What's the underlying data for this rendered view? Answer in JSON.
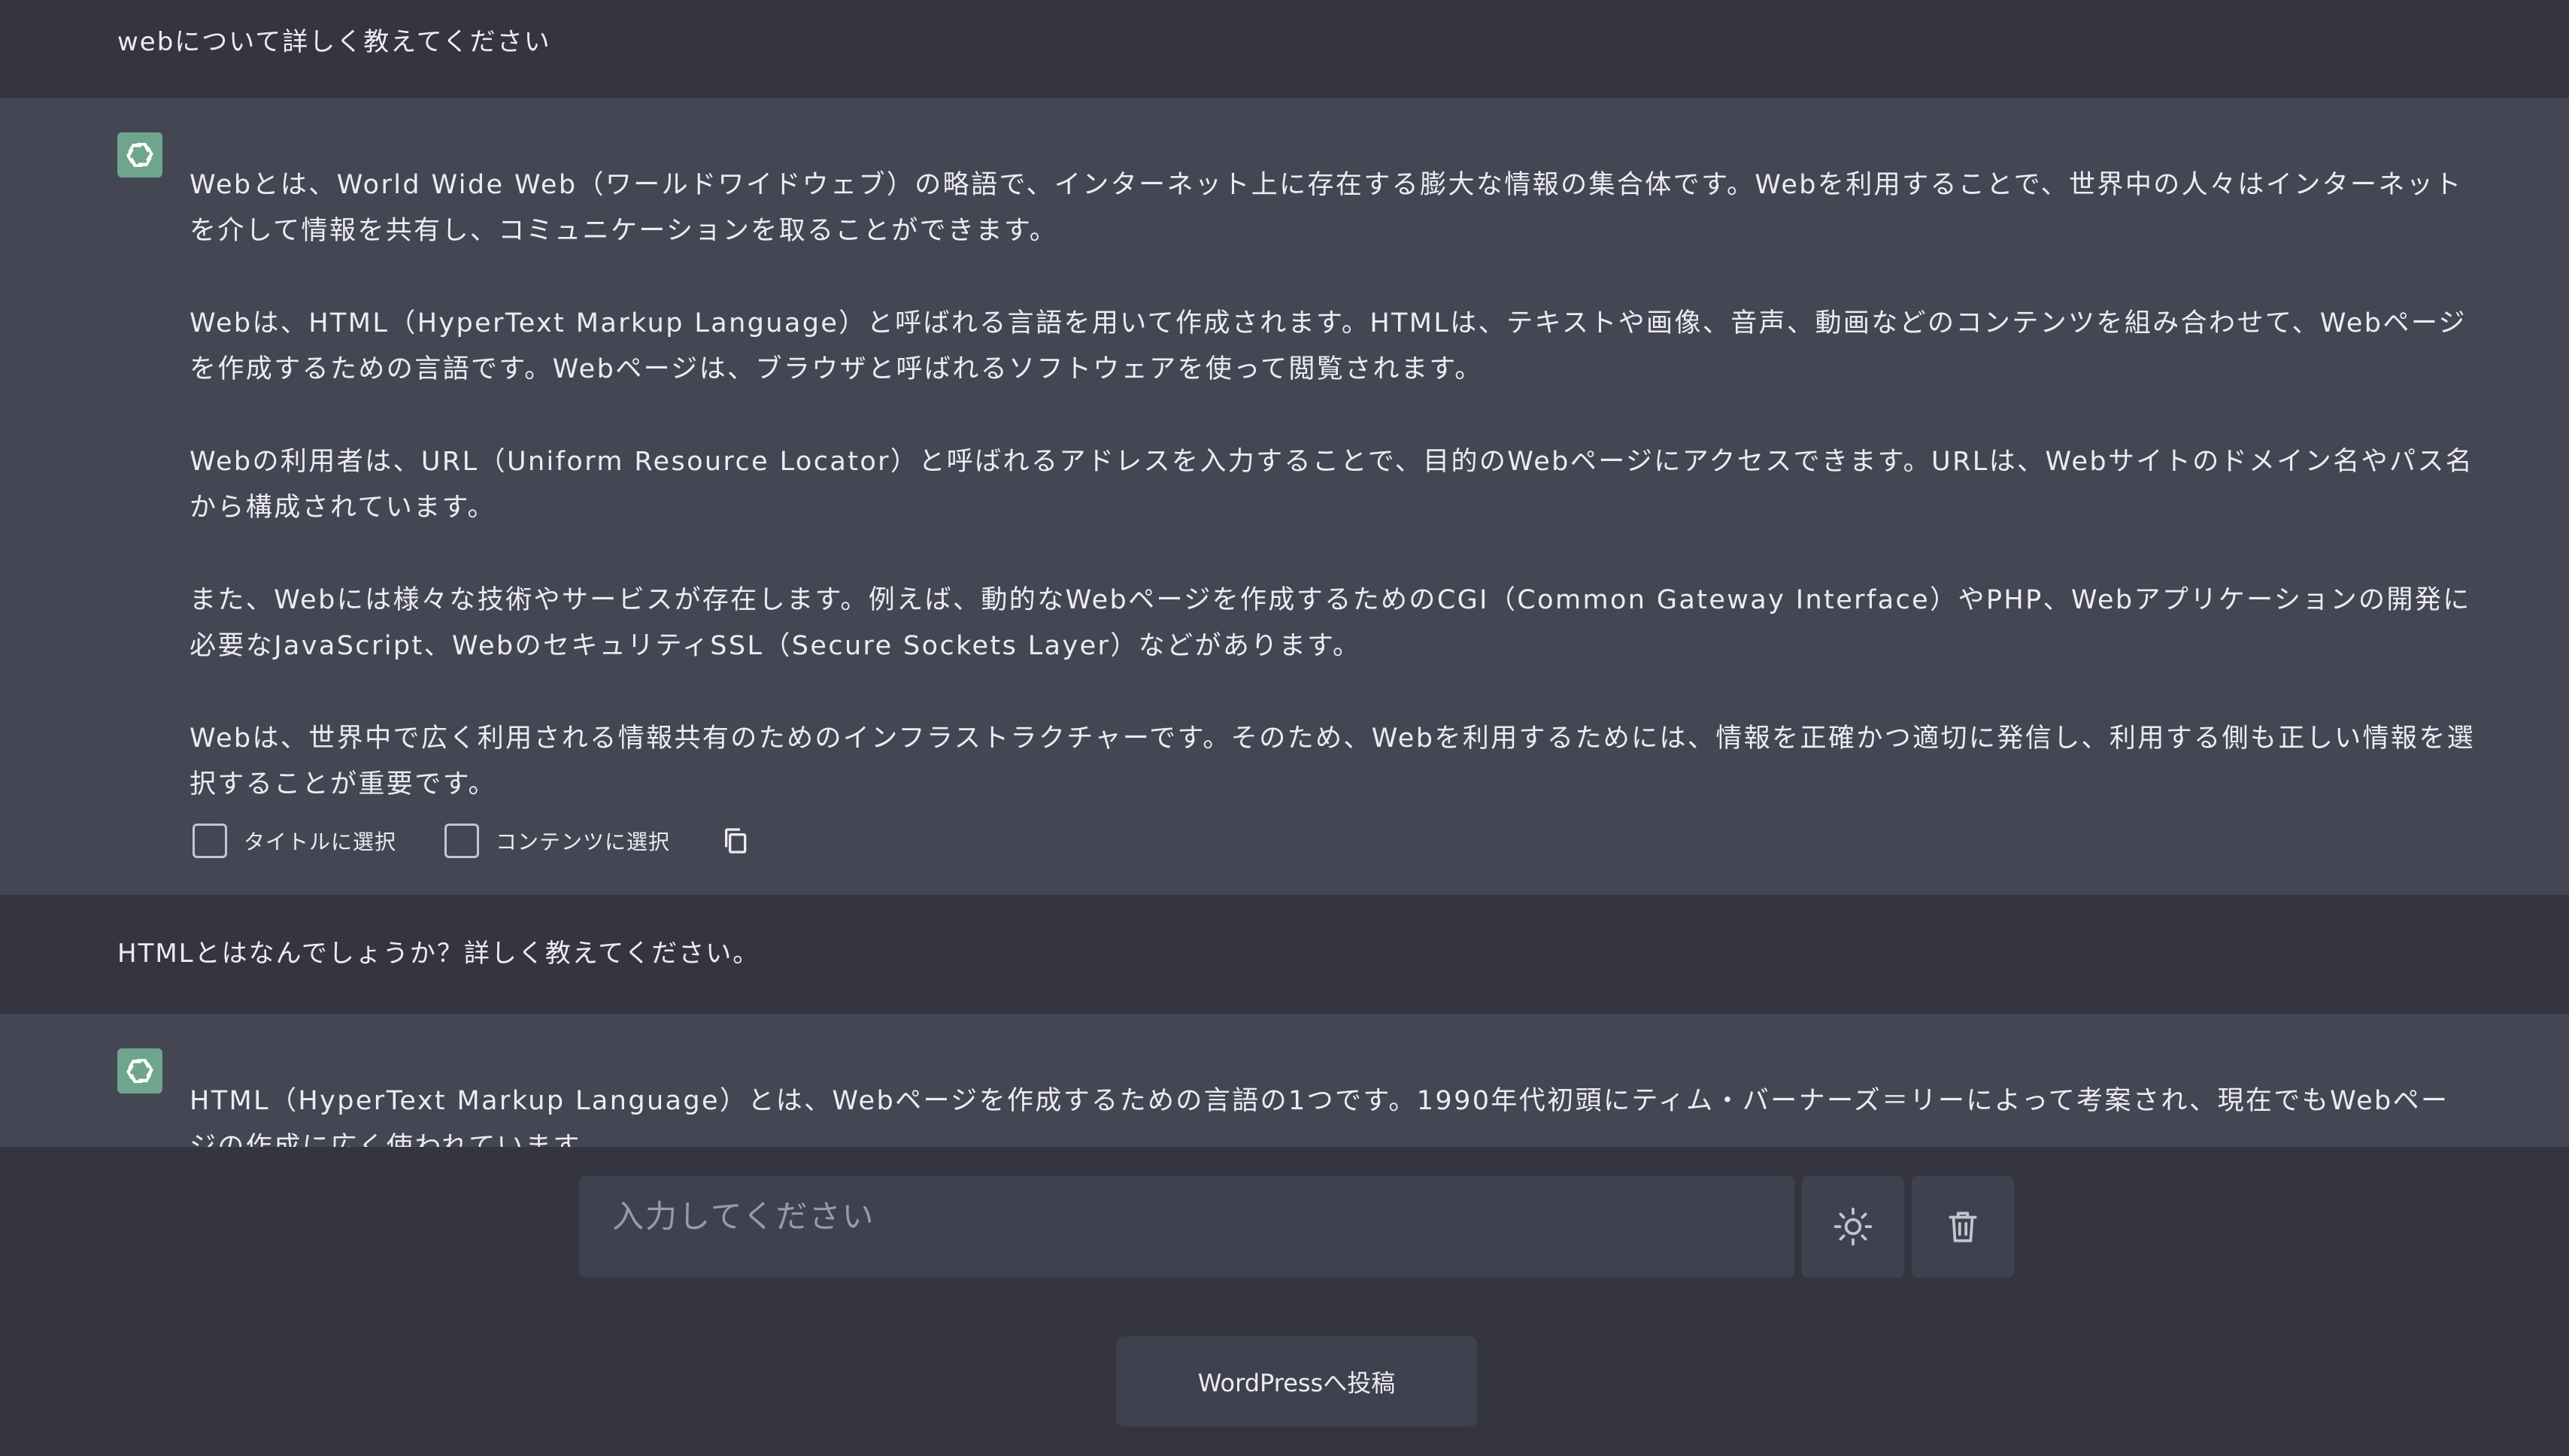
{
  "conversation": {
    "user_1": "webについて詳しく教えてください",
    "bot_1": {
      "paragraphs": [
        "Webとは、World Wide Web（ワールドワイドウェブ）の略語で、インターネット上に存在する膨大な情報の集合体です。Webを利用することで、世界中の人々はインターネットを介して情報を共有し、コミュニケーションを取ることができます。",
        "Webは、HTML（HyperText Markup Language）と呼ばれる言語を用いて作成されます。HTMLは、テキストや画像、音声、動画などのコンテンツを組み合わせて、Webページを作成するための言語です。Webページは、ブラウザと呼ばれるソフトウェアを使って閲覧されます。",
        "Webの利用者は、URL（Uniform Resource Locator）と呼ばれるアドレスを入力することで、目的のWebページにアクセスできます。URLは、Webサイトのドメイン名やパス名から構成されています。",
        "また、Webには様々な技術やサービスが存在します。例えば、動的なWebページを作成するためのCGI（Common Gateway Interface）やPHP、Webアプリケーションの開発に必要なJavaScript、WebのセキュリティSSL（Secure Sockets Layer）などがあります。",
        "Webは、世界中で広く利用される情報共有のためのインフラストラクチャーです。そのため、Webを利用するためには、情報を正確かつ適切に発信し、利用する側も正しい情報を選択することが重要です。"
      ],
      "actions": {
        "select_title": "タイトルに選択",
        "select_content": "コンテンツに選択"
      }
    },
    "user_2": "HTMLとはなんでしょうか？詳しく教えてください。",
    "bot_2": {
      "paragraphs": [
        "HTML（HyperText Markup Language）とは、Webページを作成するための言語の1つです。1990年代初頭にティム・バーナーズ＝リーによって考案され、現在でもWebページの作成に広く使われています。"
      ]
    }
  },
  "composer": {
    "placeholder": "入力してください",
    "theme_icon": "sun-icon",
    "delete_icon": "trash-icon"
  },
  "post_button": {
    "label": "WordPressへ投稿"
  },
  "colors": {
    "background": "#343541",
    "bot_background": "#444654",
    "input_background": "#40414f",
    "avatar": "#6fa58e",
    "text": "#ececf1"
  }
}
